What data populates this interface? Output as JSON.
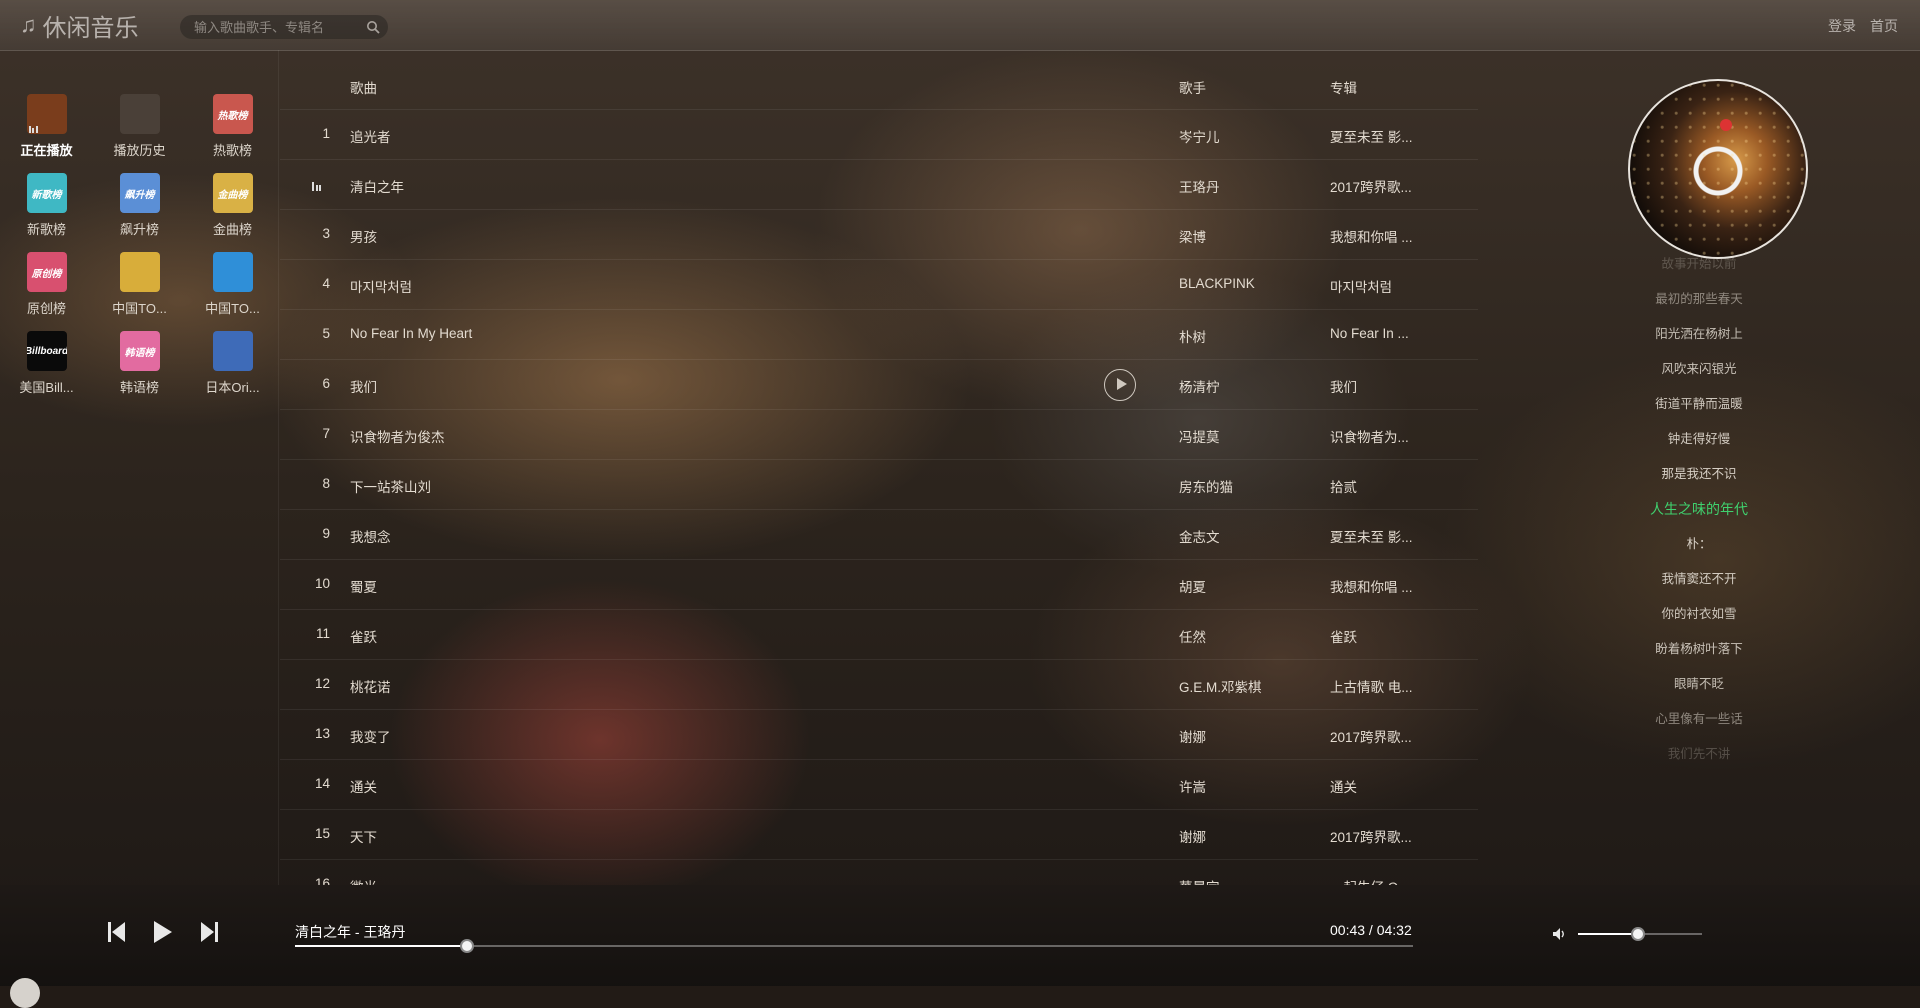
{
  "app": {
    "logo_text": "休闲音乐",
    "logo_icon": "music-note-icon"
  },
  "search": {
    "placeholder": "输入歌曲歌手、专辑名",
    "icon": "search-icon"
  },
  "top_links": {
    "login": "登录",
    "home": "首页"
  },
  "categories": [
    {
      "label": "正在播放",
      "tile_text": "",
      "color": "#7a3d1c",
      "active": true
    },
    {
      "label": "播放历史",
      "tile_text": "",
      "color": "#4a4038"
    },
    {
      "label": "热歌榜",
      "tile_text": "热歌榜",
      "color": "#c9574e"
    },
    {
      "label": "新歌榜",
      "tile_text": "新歌榜",
      "color": "#3fb8c4"
    },
    {
      "label": "飙升榜",
      "tile_text": "飙升榜",
      "color": "#5b8fd6"
    },
    {
      "label": "金曲榜",
      "tile_text": "金曲榜",
      "color": "#d9b145"
    },
    {
      "label": "原创榜",
      "tile_text": "原创榜",
      "color": "#d8506f"
    },
    {
      "label": "中国TO...",
      "tile_text": "",
      "color": "#d8ad3a"
    },
    {
      "label": "中国TO...",
      "tile_text": "",
      "color": "#2f8fd8"
    },
    {
      "label": "美国Bill...",
      "tile_text": "Billboard",
      "color": "#0a0a0a"
    },
    {
      "label": "韩语榜",
      "tile_text": "韩语榜",
      "color": "#e26ba0"
    },
    {
      "label": "日本Ori...",
      "tile_text": "",
      "color": "#3e6bb8"
    }
  ],
  "table": {
    "headers": {
      "song": "歌曲",
      "artist": "歌手",
      "album": "专辑"
    },
    "rows": [
      {
        "num": "1",
        "song": "追光者",
        "artist": "岑宁儿",
        "album": "夏至未至 影..."
      },
      {
        "num": "",
        "song": "清白之年",
        "artist": "王珞丹",
        "album": "2017跨界歌...",
        "playing": true
      },
      {
        "num": "3",
        "song": "男孩",
        "artist": "梁博",
        "album": "我想和你唱 ..."
      },
      {
        "num": "4",
        "song": "마지막처럼",
        "artist": "BLACKPINK",
        "album": "마지막처럼"
      },
      {
        "num": "5",
        "song": "No Fear In My Heart",
        "artist": "朴树",
        "album": "No Fear In ..."
      },
      {
        "num": "6",
        "song": "我们",
        "artist": "杨清柠",
        "album": "我们",
        "hover": true
      },
      {
        "num": "7",
        "song": "识食物者为俊杰",
        "artist": "冯提莫",
        "album": "识食物者为..."
      },
      {
        "num": "8",
        "song": "下一站茶山刘",
        "artist": "房东的猫",
        "album": "拾贰"
      },
      {
        "num": "9",
        "song": "我想念",
        "artist": "金志文",
        "album": "夏至未至 影..."
      },
      {
        "num": "10",
        "song": "蜀夏",
        "artist": "胡夏",
        "album": "我想和你唱 ..."
      },
      {
        "num": "11",
        "song": "雀跃",
        "artist": "任然",
        "album": "雀跃"
      },
      {
        "num": "12",
        "song": "桃花诺",
        "artist": "G.E.M.邓紫棋",
        "album": "上古情歌 电..."
      },
      {
        "num": "13",
        "song": "我变了",
        "artist": "谢娜",
        "album": "2017跨界歌..."
      },
      {
        "num": "14",
        "song": "通关",
        "artist": "许嵩",
        "album": "通关"
      },
      {
        "num": "15",
        "song": "天下",
        "artist": "谢娜",
        "album": "2017跨界歌..."
      },
      {
        "num": "16",
        "song": "微光",
        "artist": "華晨宇",
        "album": "一起牛仔 OST..."
      }
    ]
  },
  "lyrics": {
    "lines": [
      "故事开始以前",
      "最初的那些春天",
      "阳光洒在杨树上",
      "风吹来闪银光",
      "街道平静而温暖",
      "钟走得好慢",
      "那是我还不识",
      "人生之味的年代",
      "朴：",
      "我情窦还不开",
      "你的衬衣如雪",
      "盼着杨树叶落下",
      "眼睛不眨",
      "心里像有一些话",
      "我们先不讲"
    ],
    "current_index": 7,
    "current_color": "#3fd16e"
  },
  "player": {
    "track": "清白之年 - 王珞丹",
    "time": "00:43 / 04:32",
    "progress": 0.154,
    "volume": 0.48,
    "icons": {
      "prev": "skip-previous-icon",
      "play": "play-icon",
      "next": "skip-next-icon",
      "volume": "volume-icon"
    }
  }
}
